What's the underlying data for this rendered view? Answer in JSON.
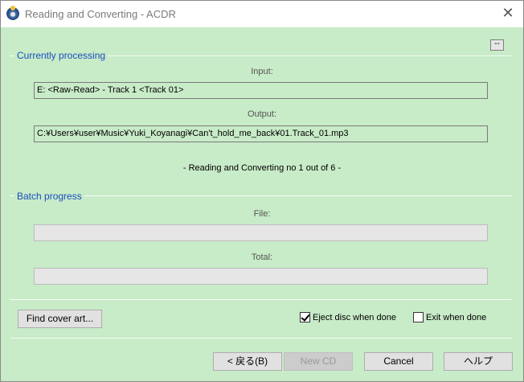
{
  "window": {
    "title": "Reading and Converting - ACDR",
    "close_glyph": "✕",
    "collapse_label": "--"
  },
  "processing": {
    "group_label": "Currently processing",
    "input_label": "Input:",
    "input_value": "E: <Raw-Read> - Track 1 <Track 01>",
    "output_label": "Output:",
    "output_value": "C:¥Users¥user¥Music¥Yuki_Koyanagi¥Can't_hold_me_back¥01.Track_01.mp3",
    "status": "- Reading and Converting no 1 out of 6 -"
  },
  "batch": {
    "group_label": "Batch progress",
    "file_label": "File:",
    "file_progress": 0,
    "total_label": "Total:",
    "total_progress": 0
  },
  "options": {
    "find_cover_label": "Find cover art...",
    "eject_label": "Eject disc when done",
    "eject_checked": true,
    "exit_label": "Exit when done",
    "exit_checked": false
  },
  "footer": {
    "back_label": "< 戻る(B)",
    "newcd_label": "New CD",
    "cancel_label": "Cancel",
    "help_label": "ヘルプ"
  },
  "colors": {
    "background": "#c8ebc8",
    "group_label": "#1b4fbf",
    "progress_fill": "#06b025"
  },
  "icons": {
    "app": "acdr-app-icon",
    "close": "close-icon"
  }
}
